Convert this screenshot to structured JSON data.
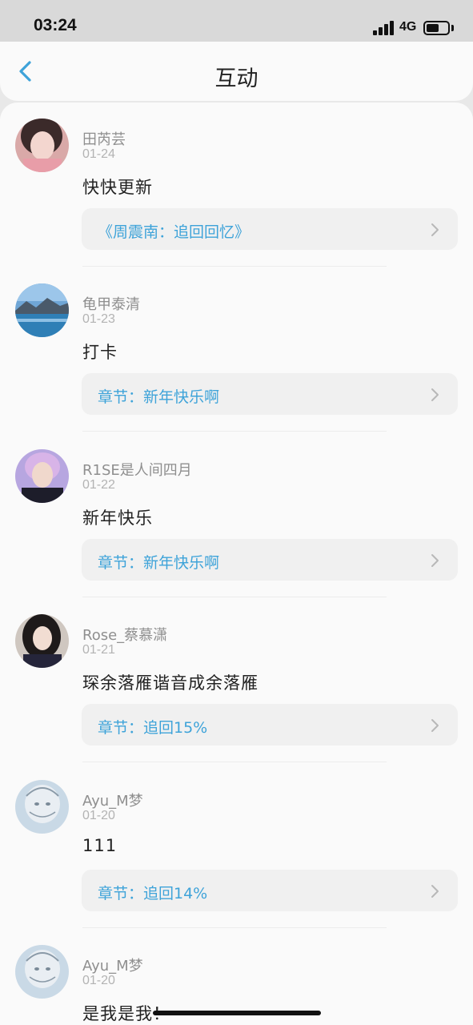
{
  "status_bar": {
    "time": "03:24",
    "network": "4G",
    "battery_level": 0.6
  },
  "nav": {
    "back_icon": "chevron-left-icon",
    "title": "互动"
  },
  "colors": {
    "accent": "#3ea3d9",
    "background": "#fafafa",
    "card": "#f0f0f0"
  },
  "comments": [
    {
      "user": "田芮芸",
      "date": "01-24",
      "text": "快快更新",
      "link": "《周震南：追回回忆》"
    },
    {
      "user": "龟甲泰清",
      "date": "01-23",
      "text": "打卡",
      "link": "章节：新年快乐啊"
    },
    {
      "user": "R1SE是人间四月",
      "date": "01-22",
      "text": "新年快乐",
      "link": "章节：新年快乐啊"
    },
    {
      "user": "Rose_蔡慕潇",
      "date": "01-21",
      "text": "琛余落雁谐音成余落雁",
      "link": "章节：追回15%"
    },
    {
      "user": "Ayu_M梦",
      "date": "01-20",
      "text": "111",
      "link": "章节：追回14%"
    },
    {
      "user": "Ayu_M梦",
      "date": "01-20",
      "text": "是我是我！",
      "link": ""
    }
  ]
}
